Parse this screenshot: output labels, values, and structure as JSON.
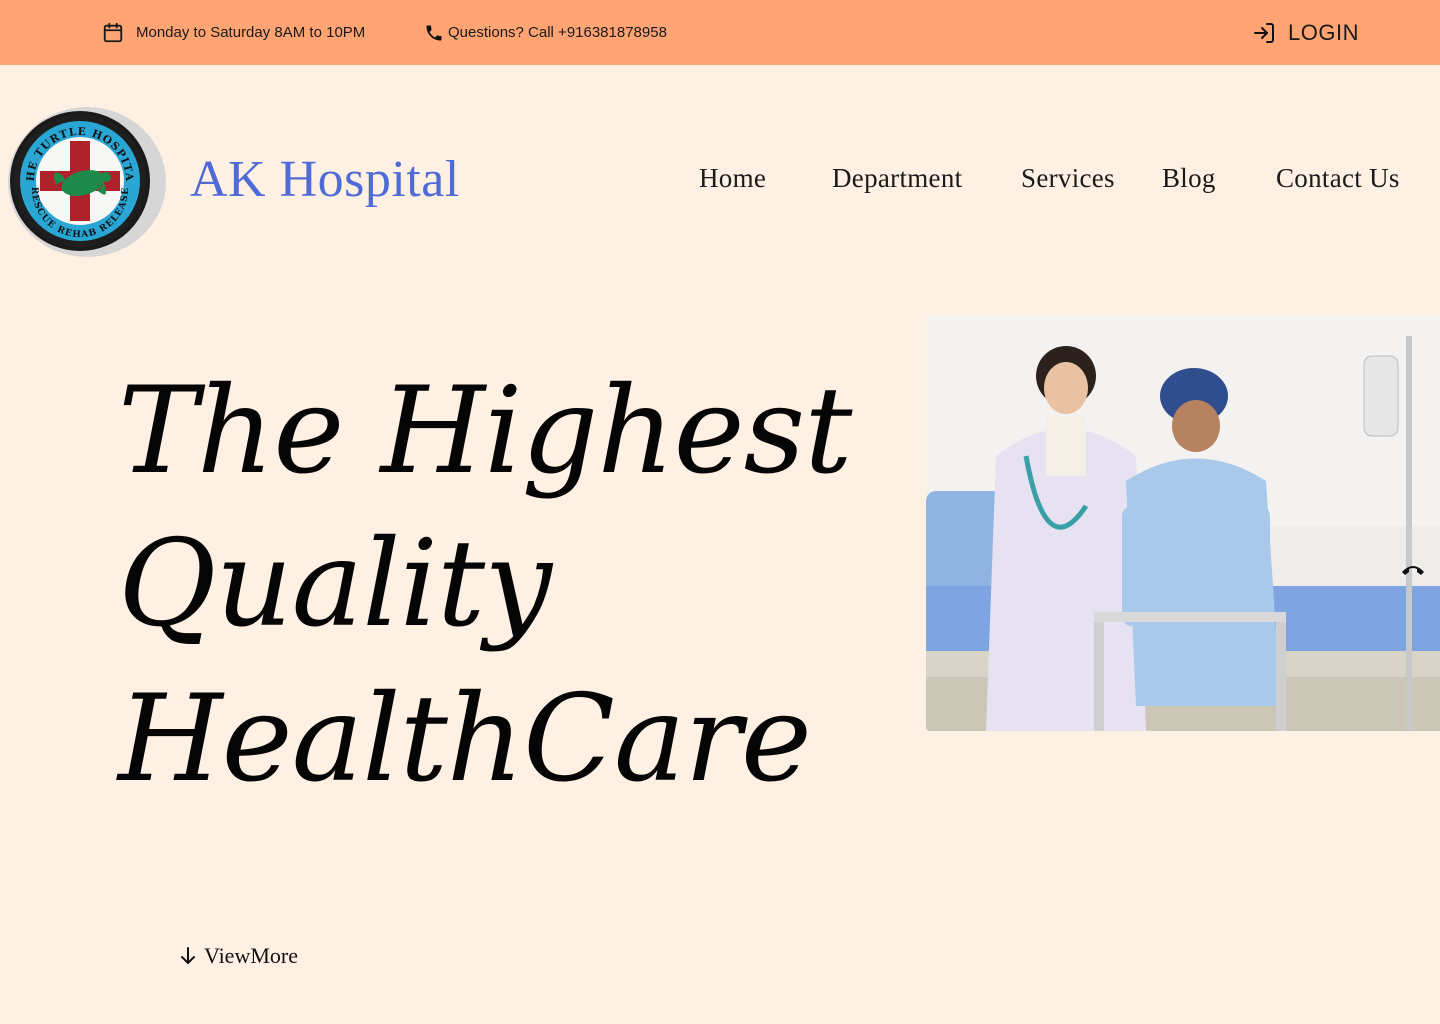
{
  "topbar": {
    "hours_text": "Monday to Saturday 8AM to 10PM",
    "phone_text": "Questions? Call +916381878958",
    "login_label": "LOGIN",
    "icons": {
      "hours": "calendar-icon",
      "phone": "phone-icon",
      "login": "login-icon"
    },
    "background": "#ffa472"
  },
  "header": {
    "logo_text": {
      "top": "THE TURTLE HOSPITAL",
      "bottom": "RESCUE REHAB RELEASE"
    },
    "brand_name": "AK Hospital",
    "brand_color": "#4f6bd6"
  },
  "nav": {
    "items": [
      {
        "label": "Home"
      },
      {
        "label": "Department"
      },
      {
        "label": "Services"
      },
      {
        "label": "Blog"
      },
      {
        "label": "Contact Us"
      }
    ]
  },
  "hero": {
    "headline_lines": [
      "The Highest",
      "Quality",
      "HealthCare"
    ],
    "view_more_label": "ViewMore",
    "view_more_icon": "arrow-down-icon",
    "image_icon": "hangup-phone-icon"
  },
  "colors": {
    "page_background": "#fff0e4",
    "text": "#111111"
  }
}
